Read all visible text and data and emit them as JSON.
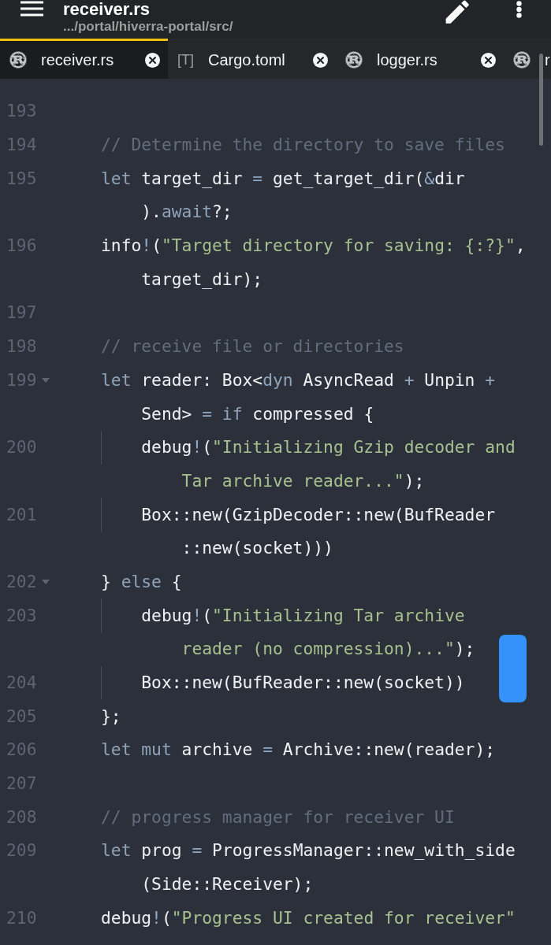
{
  "app_bar": {
    "title": "receiver.rs",
    "path": ".../portal/hiverra-portal/src/"
  },
  "tabs": [
    {
      "label": "receiver.rs",
      "kind": "rust",
      "selected": true,
      "closable": true
    },
    {
      "label": "Cargo.toml",
      "kind": "toml",
      "icon_text": "[T]",
      "selected": false,
      "closable": true
    },
    {
      "label": "logger.rs",
      "kind": "rust",
      "selected": false,
      "closable": true
    },
    {
      "label": "r",
      "kind": "rust",
      "selected": false,
      "closable": false
    }
  ],
  "editor": {
    "lines": [
      {
        "number": "193"
      },
      {
        "number": "194",
        "rows": [
          {
            "tokens": [
              {
                "kind": "comment",
                "text": "// Determine the directory to save files"
              }
            ]
          }
        ]
      },
      {
        "number": "195",
        "rows": [
          {
            "tokens": [
              {
                "kind": "keyword",
                "text": "let"
              },
              {
                "kind": "plain",
                "text": " target_dir "
              },
              {
                "kind": "operator",
                "text": "="
              },
              {
                "kind": "plain",
                "text": " get_target_dir("
              },
              {
                "kind": "operator",
                "text": "&"
              },
              {
                "kind": "plain",
                "text": "dir"
              }
            ]
          },
          {
            "tokens": [
              {
                "kind": "plain",
                "text": ")."
              },
              {
                "kind": "keyword",
                "text": "await"
              },
              {
                "kind": "plain",
                "text": "?;"
              }
            ]
          }
        ]
      },
      {
        "number": "196",
        "rows": [
          {
            "tokens": [
              {
                "kind": "plain",
                "text": "info"
              },
              {
                "kind": "operator",
                "text": "!"
              },
              {
                "kind": "plain",
                "text": "("
              },
              {
                "kind": "string",
                "text": "\"Target directory for saving: {:?}\""
              },
              {
                "kind": "plain",
                "text": ","
              }
            ]
          },
          {
            "tokens": [
              {
                "kind": "plain",
                "text": "target_dir);"
              }
            ]
          }
        ]
      },
      {
        "number": "197"
      },
      {
        "number": "198",
        "rows": [
          {
            "tokens": [
              {
                "kind": "comment",
                "text": "// receive file or directories"
              }
            ]
          }
        ]
      },
      {
        "number": "199",
        "expanded": true,
        "rows": [
          {
            "tokens": [
              {
                "kind": "keyword",
                "text": "let"
              },
              {
                "kind": "plain",
                "text": " reader: Box<"
              },
              {
                "kind": "keyword",
                "text": "dyn"
              },
              {
                "kind": "plain",
                "text": " AsyncRead "
              },
              {
                "kind": "operator",
                "text": "+"
              },
              {
                "kind": "plain",
                "text": " Unpin "
              },
              {
                "kind": "operator",
                "text": "+"
              }
            ]
          },
          {
            "tokens": [
              {
                "kind": "plain",
                "text": "Send> "
              },
              {
                "kind": "operator",
                "text": "="
              },
              {
                "kind": "keyword",
                "text": " if"
              },
              {
                "kind": "plain",
                "text": " compressed {"
              }
            ]
          }
        ],
        "children": [
          {
            "number": "200",
            "rows": [
              {
                "tokens": [
                  {
                    "kind": "plain",
                    "text": "debug"
                  },
                  {
                    "kind": "operator",
                    "text": "!"
                  },
                  {
                    "kind": "plain",
                    "text": "("
                  },
                  {
                    "kind": "string",
                    "text": "\"Initializing Gzip decoder and"
                  }
                ]
              },
              {
                "tokens": [
                  {
                    "kind": "string",
                    "text": "Tar archive reader...\""
                  },
                  {
                    "kind": "plain",
                    "text": ");"
                  }
                ]
              }
            ]
          },
          {
            "number": "201",
            "rows": [
              {
                "tokens": [
                  {
                    "kind": "plain",
                    "text": "Box::new(GzipDecoder::new(BufReader"
                  }
                ]
              },
              {
                "tokens": [
                  {
                    "kind": "plain",
                    "text": "::new(socket)))"
                  }
                ]
              }
            ]
          }
        ]
      },
      {
        "number": "202",
        "expanded": true,
        "rows": [
          {
            "tokens": [
              {
                "kind": "plain",
                "text": "} "
              },
              {
                "kind": "keyword",
                "text": "else"
              },
              {
                "kind": "plain",
                "text": " {"
              }
            ]
          }
        ],
        "children": [
          {
            "number": "203",
            "rows": [
              {
                "tokens": [
                  {
                    "kind": "plain",
                    "text": "debug"
                  },
                  {
                    "kind": "operator",
                    "text": "!"
                  },
                  {
                    "kind": "plain",
                    "text": "("
                  },
                  {
                    "kind": "string",
                    "text": "\"Initializing Tar archive"
                  }
                ]
              },
              {
                "tokens": [
                  {
                    "kind": "string",
                    "text": "reader (no compression)...\""
                  },
                  {
                    "kind": "plain",
                    "text": ");"
                  }
                ]
              }
            ]
          },
          {
            "number": "204",
            "rows": [
              {
                "tokens": [
                  {
                    "kind": "plain",
                    "text": "Box::new(BufReader::new(socket))"
                  }
                ]
              }
            ]
          }
        ]
      },
      {
        "number": "205",
        "rows": [
          {
            "tokens": [
              {
                "kind": "plain",
                "text": "};"
              }
            ]
          }
        ]
      },
      {
        "number": "206",
        "rows": [
          {
            "tokens": [
              {
                "kind": "keyword",
                "text": "let"
              },
              {
                "kind": "keyword",
                "text": " mut"
              },
              {
                "kind": "plain",
                "text": " archive "
              },
              {
                "kind": "operator",
                "text": "="
              },
              {
                "kind": "plain",
                "text": " Archive::new(reader);"
              }
            ]
          }
        ]
      },
      {
        "number": "207"
      },
      {
        "number": "208",
        "rows": [
          {
            "tokens": [
              {
                "kind": "comment",
                "text": "// progress manager for receiver UI"
              }
            ]
          }
        ]
      },
      {
        "number": "209",
        "rows": [
          {
            "tokens": [
              {
                "kind": "keyword",
                "text": "let"
              },
              {
                "kind": "plain",
                "text": " prog "
              },
              {
                "kind": "operator",
                "text": "="
              },
              {
                "kind": "plain",
                "text": " ProgressManager::new_with_side"
              }
            ]
          },
          {
            "tokens": [
              {
                "kind": "plain",
                "text": "(Side::Receiver);"
              }
            ]
          }
        ]
      },
      {
        "number": "210",
        "rows": [
          {
            "tokens": [
              {
                "kind": "plain",
                "text": "debug"
              },
              {
                "kind": "operator",
                "text": "!"
              },
              {
                "kind": "plain",
                "text": "("
              },
              {
                "kind": "string",
                "text": "\"Progress UI created for receiver\""
              }
            ]
          }
        ]
      }
    ]
  }
}
